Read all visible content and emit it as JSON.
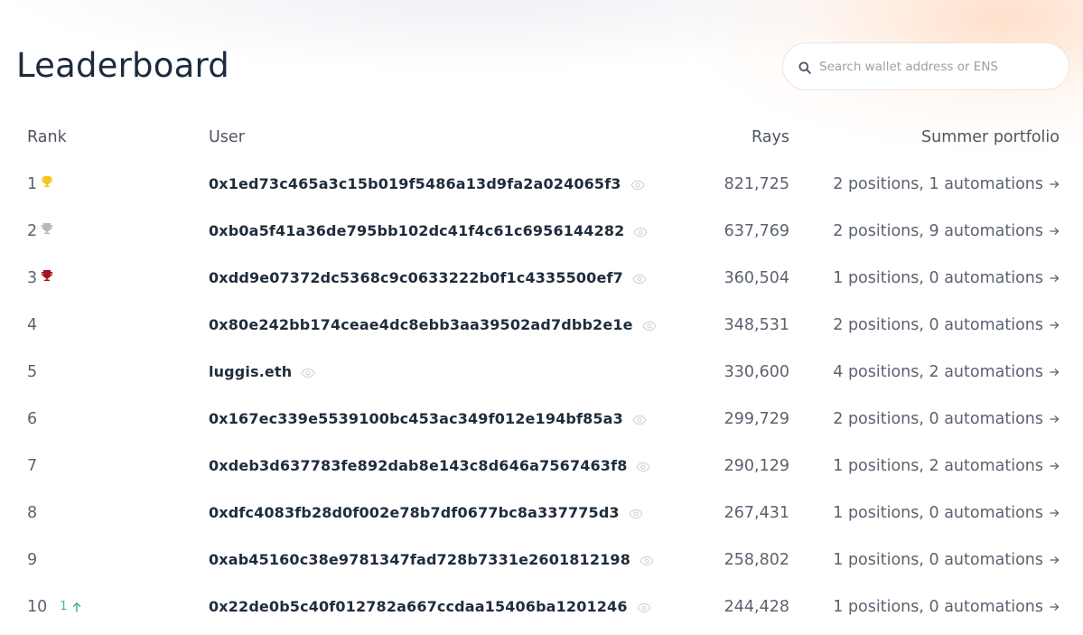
{
  "page": {
    "title": "Leaderboard"
  },
  "search": {
    "placeholder": "Search wallet address or ENS",
    "value": "",
    "icon": "search-icon"
  },
  "table": {
    "headers": {
      "rank": "Rank",
      "user": "User",
      "rays": "Rays",
      "portfolio": "Summer portfolio"
    },
    "rows": [
      {
        "rank": "1",
        "trophy": "gold",
        "user": "0x1ed73c465a3c15b019f5486a13d9fa2a024065f3",
        "rays": "821,725",
        "portfolio": "2 positions, 1 automations"
      },
      {
        "rank": "2",
        "trophy": "silver",
        "user": "0xb0a5f41a36de795bb102dc41f4c61c6956144282",
        "rays": "637,769",
        "portfolio": "2 positions, 9 automations"
      },
      {
        "rank": "3",
        "trophy": "bronze",
        "user": "0xdd9e07372dc5368c9c0633222b0f1c4335500ef7",
        "rays": "360,504",
        "portfolio": "1 positions, 0 automations"
      },
      {
        "rank": "4",
        "user": "0x80e242bb174ceae4dc8ebb3aa39502ad7dbb2e1e",
        "rays": "348,531",
        "portfolio": "2 positions, 0 automations"
      },
      {
        "rank": "5",
        "user": "luggis.eth",
        "rays": "330,600",
        "portfolio": "4 positions, 2 automations"
      },
      {
        "rank": "6",
        "user": "0x167ec339e5539100bc453ac349f012e194bf85a3",
        "rays": "299,729",
        "portfolio": "2 positions, 0 automations"
      },
      {
        "rank": "7",
        "user": "0xdeb3d637783fe892dab8e143c8d646a7567463f8",
        "rays": "290,129",
        "portfolio": "1 positions, 2 automations"
      },
      {
        "rank": "8",
        "user": "0xdfc4083fb28d0f002e78b7df0677bc8a337775d3",
        "rays": "267,431",
        "portfolio": "1 positions, 0 automations"
      },
      {
        "rank": "9",
        "user": "0xab45160c38e9781347fad728b7331e2601812198",
        "rays": "258,802",
        "portfolio": "1 positions, 0 automations"
      },
      {
        "rank": "10",
        "change": "1",
        "user": "0x22de0b5c40f012782a667ccdaa15406ba1201246",
        "rays": "244,428",
        "portfolio": "1 positions, 0 automations"
      }
    ]
  },
  "colors": {
    "gold": "#f5c518",
    "silver": "#b7b7b7",
    "bronze": "#a3121c",
    "change_up": "#45b39d"
  }
}
